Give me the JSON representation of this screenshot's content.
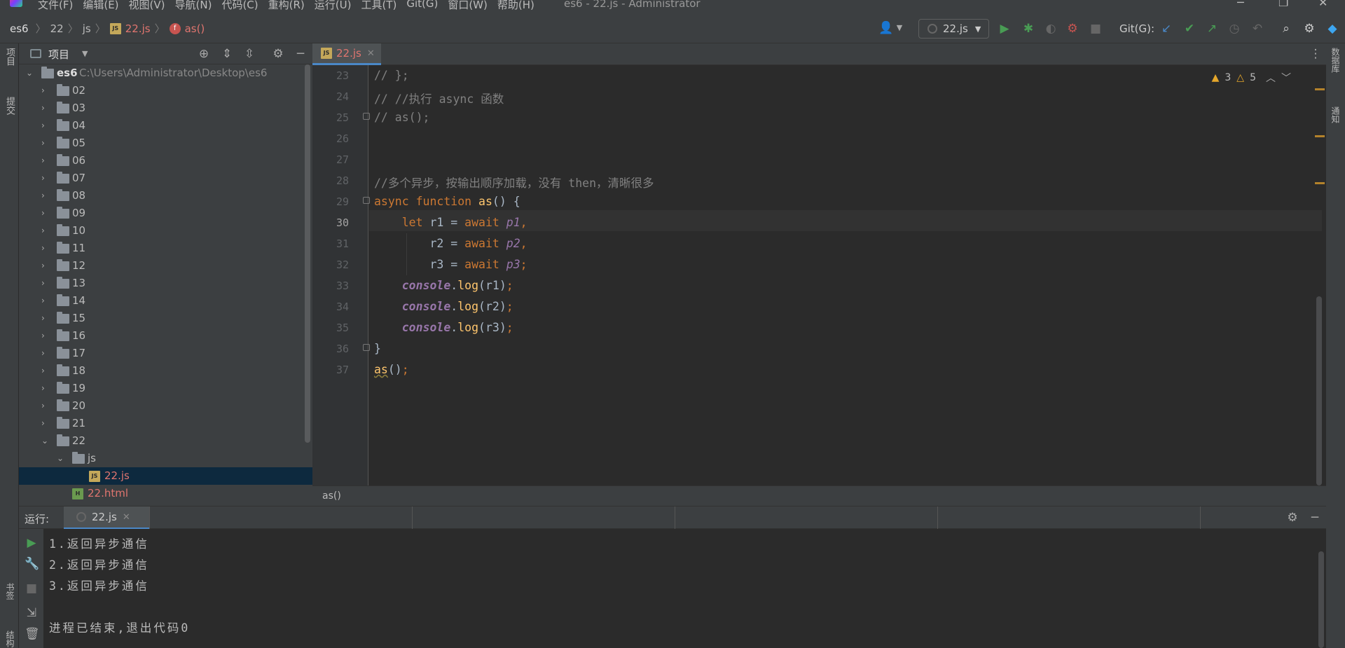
{
  "menubar": {
    "items": [
      "文件(F)",
      "编辑(E)",
      "视图(V)",
      "导航(N)",
      "代码(C)",
      "重构(R)",
      "运行(U)",
      "工具(T)",
      "Git(G)",
      "窗口(W)",
      "帮助(H)"
    ],
    "window_title": "es6 - 22.js - Administrator",
    "win_min": "─",
    "win_restore": "❐",
    "win_close": "✕"
  },
  "navbar": {
    "breadcrumb": [
      "es6",
      "22",
      "js",
      "22.js",
      "as()"
    ],
    "run_config": "22.js",
    "git_label": "Git(G):"
  },
  "sidebar_left": {
    "project_tab": "项目",
    "commit_tab": "提交",
    "bookmarks_tab": "书签",
    "structure_tab": "结构"
  },
  "sidebar_right": {
    "database_tab": "数据库",
    "notifications_tab": "通知"
  },
  "project": {
    "header_label": "项目",
    "root_name": "es6",
    "root_path": "C:\\Users\\Administrator\\Desktop\\es6",
    "folders": [
      "02",
      "03",
      "04",
      "05",
      "06",
      "07",
      "08",
      "09",
      "10",
      "11",
      "12",
      "13",
      "14",
      "15",
      "16",
      "17",
      "18",
      "19",
      "20",
      "21",
      "22"
    ],
    "subfolder": "js",
    "file_js": "22.js",
    "file_html": "22.html"
  },
  "editor": {
    "tab_label": "22.js",
    "warnings_a": "3",
    "warnings_b": "5",
    "line_numbers": [
      "23",
      "24",
      "25",
      "26",
      "27",
      "28",
      "29",
      "30",
      "31",
      "32",
      "33",
      "34",
      "35",
      "36",
      "37"
    ],
    "lines": {
      "l23": "// };",
      "l24": "// //执行 async 函数",
      "l25": "// as();",
      "l28": "//多个异步，按输出顺序加载，没有 then，清晰很多",
      "async": "async",
      "function": "function",
      "as": "as",
      "paren_open": "() {",
      "let": "let",
      "r1": " r1 = ",
      "r2": "r2 = ",
      "r3": "r3 = ",
      "await": "await",
      "p1": "p1",
      "p2": "p2",
      "p3": "p3",
      "comma": ",",
      "semi": ";",
      "console": "console",
      "log": "log",
      "arg1": "(r1)",
      "arg2": "(r2)",
      "arg3": "(r3)",
      "dot": ".",
      "close_brace": "}",
      "call_as": "as",
      "call_paren": "()"
    },
    "breadcrumb_bottom": "as()"
  },
  "run": {
    "label": "运行:",
    "tab": "22.js",
    "output": [
      "1.返回异步通信",
      "2.返回异步通信",
      "3.返回异步通信",
      "",
      "进程已结束,退出代码0"
    ]
  },
  "colors": {
    "accent": "#4a88c7",
    "keyword": "#cc7832",
    "function": "#ffc66d",
    "comment": "#808080",
    "warning": "#e5a72b"
  }
}
